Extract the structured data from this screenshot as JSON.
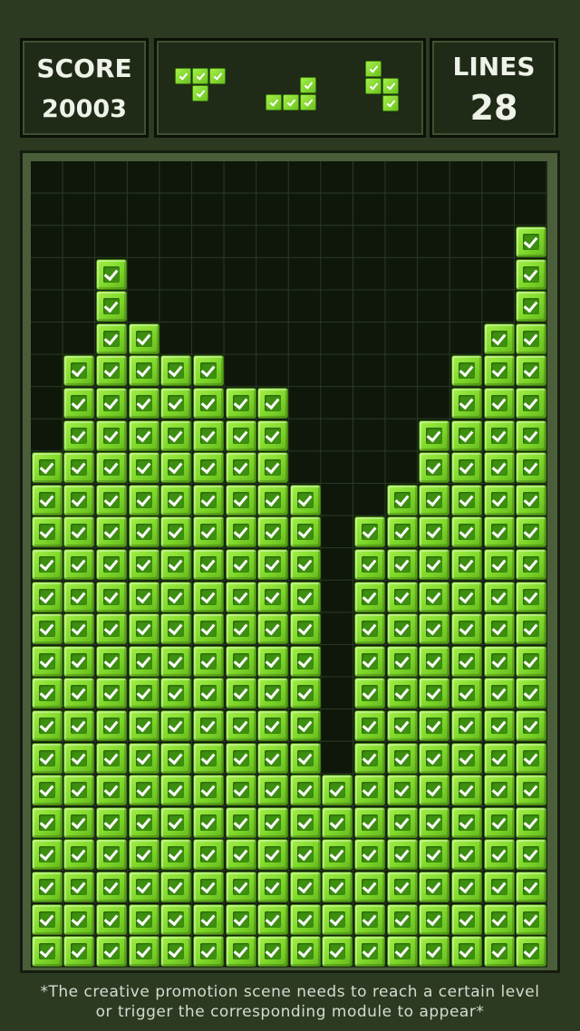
{
  "hud": {
    "score_label": "SCORE",
    "score_value": "20003",
    "lines_label": "LINES",
    "lines_value": "28"
  },
  "next_pieces": [
    {
      "shape": "T",
      "cells": [
        [
          0,
          0
        ],
        [
          1,
          0
        ],
        [
          2,
          0
        ],
        [
          1,
          1
        ]
      ]
    },
    {
      "shape": "J",
      "cells": [
        [
          2,
          0
        ],
        [
          0,
          1
        ],
        [
          1,
          1
        ],
        [
          2,
          1
        ]
      ]
    },
    {
      "shape": "S",
      "cells": [
        [
          0,
          0
        ],
        [
          0,
          1
        ],
        [
          1,
          1
        ],
        [
          1,
          2
        ]
      ]
    }
  ],
  "board": {
    "columns": 16,
    "rows": 25,
    "column_heights": [
      16,
      19,
      22,
      20,
      19,
      19,
      18,
      18,
      15,
      6,
      14,
      15,
      17,
      19,
      20,
      23
    ]
  },
  "footer": {
    "line1": "*The creative promotion scene needs to reach a certain level",
    "line2": "or trigger the corresponding module to appear*"
  },
  "colors": {
    "block": "#8be13a",
    "board_bg": "#0f170b",
    "page_bg": "#2c3a22"
  }
}
